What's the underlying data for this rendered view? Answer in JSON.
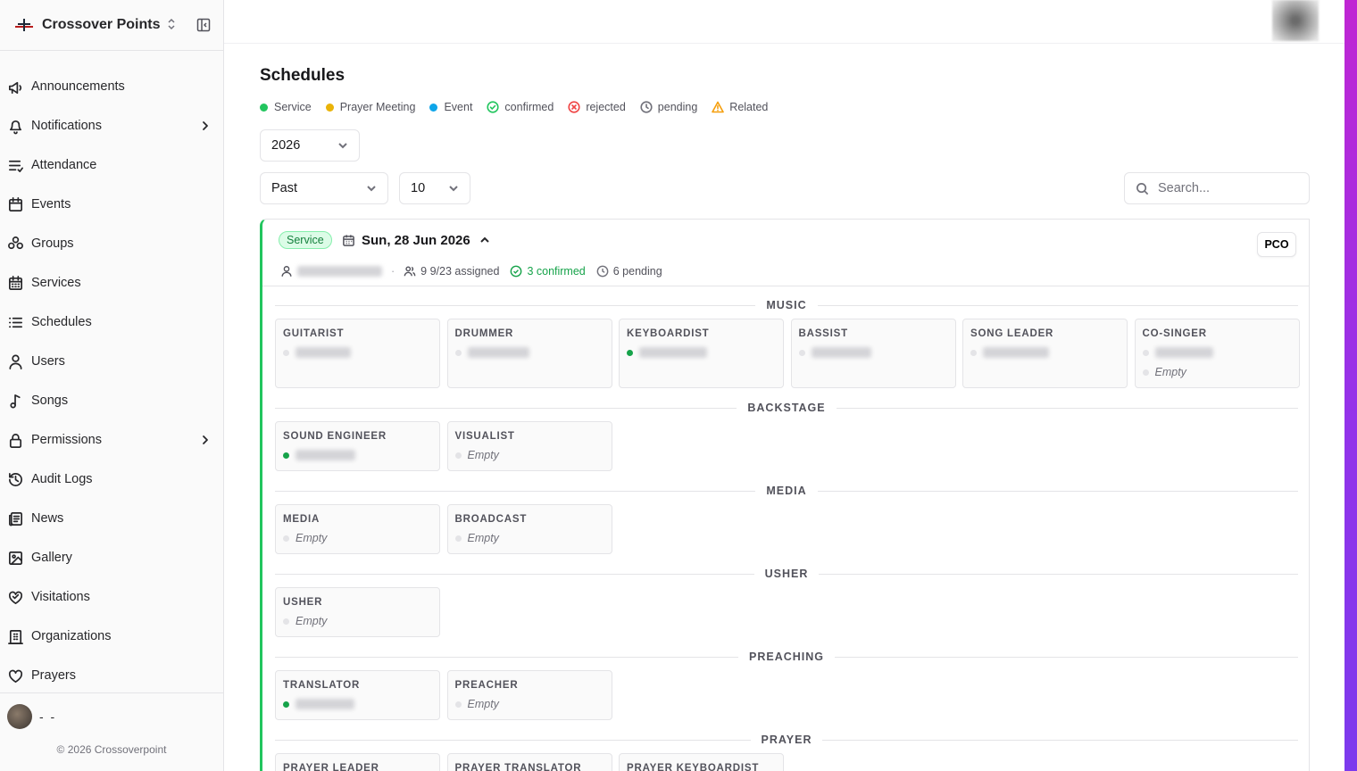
{
  "app": {
    "name": "Crossover Points",
    "logo_icon": "crossover-logo-icon"
  },
  "sidebar": {
    "items": [
      {
        "label": "Announcements",
        "icon": "megaphone-icon",
        "chevron": false
      },
      {
        "label": "Notifications",
        "icon": "bell-icon",
        "chevron": true
      },
      {
        "label": "Attendance",
        "icon": "list-check-icon",
        "chevron": false
      },
      {
        "label": "Events",
        "icon": "calendar-icon",
        "chevron": false
      },
      {
        "label": "Groups",
        "icon": "groups-icon",
        "chevron": false
      },
      {
        "label": "Services",
        "icon": "calendar-days-icon",
        "chevron": false
      },
      {
        "label": "Schedules",
        "icon": "list-icon",
        "chevron": false
      },
      {
        "label": "Users",
        "icon": "user-icon",
        "chevron": false
      },
      {
        "label": "Songs",
        "icon": "music-note-icon",
        "chevron": false
      },
      {
        "label": "Permissions",
        "icon": "lock-icon",
        "chevron": true
      },
      {
        "label": "Audit Logs",
        "icon": "history-icon",
        "chevron": false
      },
      {
        "label": "News",
        "icon": "newspaper-icon",
        "chevron": false
      },
      {
        "label": "Gallery",
        "icon": "image-icon",
        "chevron": false
      },
      {
        "label": "Visitations",
        "icon": "heart-handshake-icon",
        "chevron": false
      },
      {
        "label": "Organizations",
        "icon": "building-icon",
        "chevron": false
      },
      {
        "label": "Prayers",
        "icon": "heart-icon",
        "chevron": false
      }
    ],
    "user": {
      "name": "- -"
    },
    "footer": "© 2026 Crossoverpoint"
  },
  "page": {
    "title": "Schedules"
  },
  "legend": [
    {
      "label": "Service",
      "kind": "dot",
      "color": "#22c55e"
    },
    {
      "label": "Prayer Meeting",
      "kind": "dot",
      "color": "#eab308"
    },
    {
      "label": "Event",
      "kind": "dot",
      "color": "#0ea5e9"
    },
    {
      "label": "confirmed",
      "kind": "check-circle-icon",
      "color": "#22c55e"
    },
    {
      "label": "rejected",
      "kind": "x-circle-icon",
      "color": "#ef4444"
    },
    {
      "label": "pending",
      "kind": "clock-icon",
      "color": "#71717a"
    },
    {
      "label": "Related",
      "kind": "warning-triangle-icon",
      "color": "#f59e0b"
    }
  ],
  "filters": {
    "year": "2026",
    "period": "Past",
    "per_page": "10",
    "search_placeholder": "Search..."
  },
  "schedule": {
    "type_badge": "Service",
    "date": "Sun, 28 Jun 2026",
    "pco_label": "PCO",
    "assigned": "9 9/23 assigned",
    "confirmed": "3 confirmed",
    "pending": "6 pending",
    "sections": [
      {
        "name": "MUSIC",
        "roles": [
          {
            "title": "GUITARIST",
            "slots": [
              {
                "status": "pending"
              }
            ]
          },
          {
            "title": "DRUMMER",
            "slots": [
              {
                "status": "pending"
              }
            ]
          },
          {
            "title": "KEYBOARDIST",
            "slots": [
              {
                "status": "confirmed"
              }
            ]
          },
          {
            "title": "BASSIST",
            "slots": [
              {
                "status": "pending"
              }
            ]
          },
          {
            "title": "SONG LEADER",
            "slots": [
              {
                "status": "pending"
              }
            ]
          },
          {
            "title": "CO-SINGER",
            "slots": [
              {
                "status": "pending"
              },
              {
                "status": "empty",
                "text": "Empty"
              }
            ]
          }
        ]
      },
      {
        "name": "BACKSTAGE",
        "roles": [
          {
            "title": "SOUND ENGINEER",
            "slots": [
              {
                "status": "confirmed"
              }
            ]
          },
          {
            "title": "VISUALIST",
            "slots": [
              {
                "status": "empty",
                "text": "Empty"
              }
            ]
          }
        ]
      },
      {
        "name": "MEDIA",
        "roles": [
          {
            "title": "MEDIA",
            "slots": [
              {
                "status": "empty",
                "text": "Empty"
              }
            ]
          },
          {
            "title": "BROADCAST",
            "slots": [
              {
                "status": "empty",
                "text": "Empty"
              }
            ]
          }
        ]
      },
      {
        "name": "USHER",
        "roles": [
          {
            "title": "USHER",
            "slots": [
              {
                "status": "empty",
                "text": "Empty"
              }
            ]
          }
        ]
      },
      {
        "name": "PREACHING",
        "roles": [
          {
            "title": "TRANSLATOR",
            "slots": [
              {
                "status": "confirmed"
              }
            ]
          },
          {
            "title": "PREACHER",
            "slots": [
              {
                "status": "empty",
                "text": "Empty"
              }
            ]
          }
        ]
      },
      {
        "name": "PRAYER",
        "roles": [
          {
            "title": "PRAYER LEADER",
            "slots": []
          },
          {
            "title": "PRAYER TRANSLATOR",
            "slots": []
          },
          {
            "title": "PRAYER KEYBOARDIST",
            "slots": []
          }
        ]
      }
    ]
  }
}
